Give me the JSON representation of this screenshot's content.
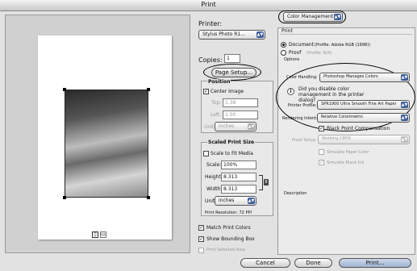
{
  "window": {
    "title": "Print"
  },
  "printer": {
    "label": "Printer:",
    "value": "Stylus Photo R1..."
  },
  "copies": {
    "label": "Copies:",
    "value": "1"
  },
  "page_setup": {
    "label": "Page Setup..."
  },
  "position": {
    "title": "Position",
    "center_image": "Center Image",
    "top_label": "Top:",
    "top_value": "1.38",
    "left_label": "Left:",
    "left_value": "1.00",
    "unit_label": "Unit:",
    "unit_value": "inches"
  },
  "scaled": {
    "title": "Scaled Print Size",
    "scale_to_fit": "Scale to Fit Media",
    "scale_label": "Scale:",
    "scale_value": "100%",
    "height_label": "Height:",
    "height_value": "8.313",
    "width_label": "Width:",
    "width_value": "8.313",
    "unit_label": "Unit:",
    "unit_value": "inches",
    "resolution": "Print Resolution: 72 PPI"
  },
  "match_print_colors": "Match Print Colors",
  "show_bounding_box": "Show Bounding Box",
  "print_selected_area": "Print Selected Area",
  "color_mgmt": {
    "popup": "Color Management"
  },
  "print_section": {
    "title": "Print",
    "document": "Document",
    "document_profile": "(Profile: Adobe RGB (1998))",
    "proof": "Proof",
    "proof_profile": "(Profile: N/A)"
  },
  "options": {
    "title": "Options",
    "color_handling_label": "Color Handling:",
    "color_handling_value": "Photoshop Manages Colors",
    "warning": "Did you disable color management in the printer dialog?",
    "printer_profile_label": "Printer Profile:",
    "printer_profile_value": "SPR1900 Ultra Smooth Fine Art Paper",
    "rendering_intent_label": "Rendering Intent:",
    "rendering_intent_value": "Relative Colorimetric",
    "black_point": "Black Point Compensation",
    "proof_setup_label": "Proof Setup:",
    "proof_setup_value": "Working CMYK",
    "simulate_paper": "Simulate Paper Color",
    "simulate_black": "Simulate Black Ink"
  },
  "description": {
    "title": "Description"
  },
  "buttons": {
    "cancel": "Cancel",
    "done": "Done",
    "print": "Print..."
  }
}
